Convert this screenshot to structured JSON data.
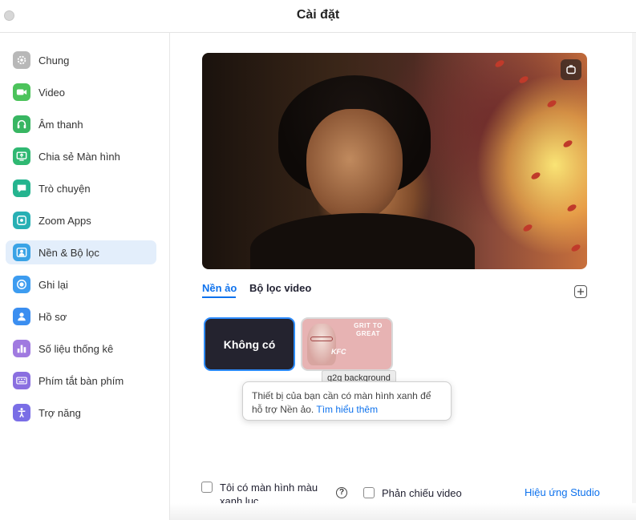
{
  "window": {
    "title": "Cài đặt"
  },
  "sidebar": {
    "items": [
      {
        "label": "Chung",
        "icon": "gear-icon",
        "color": "#b8b8b8"
      },
      {
        "label": "Video",
        "icon": "video-camera-icon",
        "color": "#4cc35b"
      },
      {
        "label": "Âm thanh",
        "icon": "headphones-icon",
        "color": "#38b662"
      },
      {
        "label": "Chia sẻ Màn hình",
        "icon": "share-screen-icon",
        "color": "#2fb872"
      },
      {
        "label": "Trò chuyện",
        "icon": "chat-bubble-icon",
        "color": "#25b48f"
      },
      {
        "label": "Zoom Apps",
        "icon": "apps-icon",
        "color": "#28b0b4"
      },
      {
        "label": "Nền & Bộ lọc",
        "icon": "background-filter-icon",
        "color": "#3aa3e6"
      },
      {
        "label": "Ghi lại",
        "icon": "record-icon",
        "color": "#3d9cf0"
      },
      {
        "label": "Hồ sơ",
        "icon": "profile-icon",
        "color": "#3b8ef0"
      },
      {
        "label": "Số liệu thống kê",
        "icon": "statistics-icon",
        "color": "#a07ae0"
      },
      {
        "label": "Phím tắt bàn phím",
        "icon": "keyboard-icon",
        "color": "#8a6fe0"
      },
      {
        "label": "Trợ năng",
        "icon": "accessibility-icon",
        "color": "#7a6ee6"
      }
    ],
    "active_index": 6
  },
  "main": {
    "tabs": [
      {
        "label": "Nền ảo",
        "active": true
      },
      {
        "label": "Bộ lọc video",
        "active": false
      }
    ],
    "backgrounds": {
      "none_label": "Không có",
      "thumbnail_text": "GRIT TO GREAT",
      "thumbnail_brand": "KFC",
      "thumbnail_tooltip": "g2g background"
    },
    "popover": {
      "text": "Thiết bị của bạn cần có màn hình xanh để hỗ trợ Nền ảo.",
      "link": "Tìm hiểu thêm"
    },
    "options": {
      "green_screen_label": "Tôi có màn hình màu xanh lục",
      "green_screen_checked": false,
      "help_glyph": "?",
      "mirror_label": "Phản chiếu video",
      "mirror_checked": false,
      "studio_link": "Hiệu ứng Studio"
    }
  },
  "colors": {
    "accent": "#0e72ed",
    "active_item_bg": "#e3eefb"
  }
}
